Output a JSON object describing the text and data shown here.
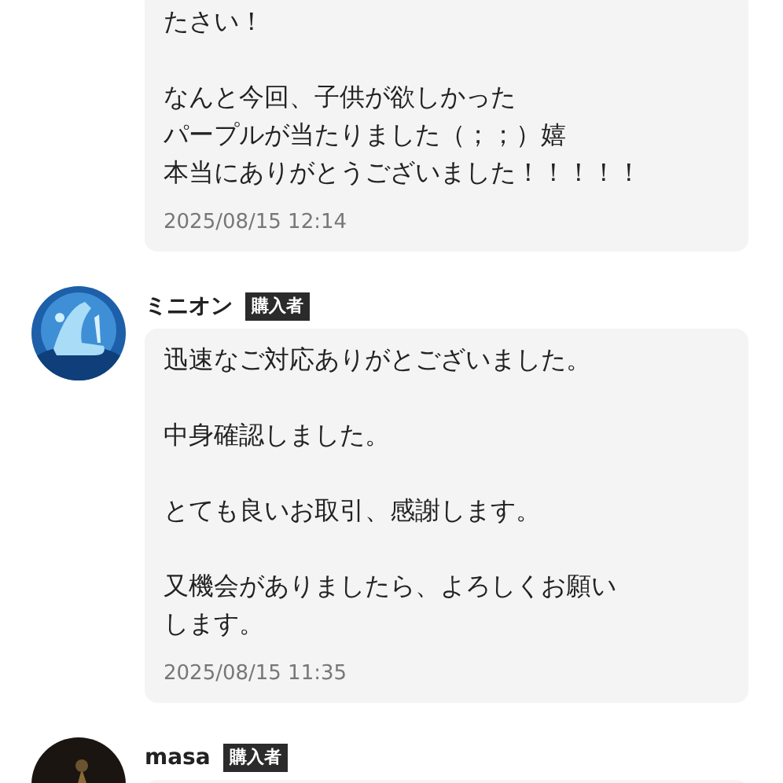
{
  "comments": [
    {
      "paragraphs": [
        [
          "たさい！"
        ],
        [
          "なんと今回、子供が欲しかった",
          "パープルが当たりました（；；）嬉",
          "本当にありがとうございました！！！！！"
        ]
      ],
      "timestamp": "2025/08/15 12:14"
    },
    {
      "avatar": {
        "kind": "picture"
      },
      "name": "ミニオン",
      "badge": "購入者",
      "paragraphs": [
        [
          "迅速なご対応ありがとございました。"
        ],
        [
          "中身確認しました。"
        ],
        [
          "とても良いお取引、感謝します。"
        ],
        [
          "又機会がありましたら、よろしくお願い",
          "します。"
        ]
      ],
      "timestamp": "2025/08/15 11:35"
    },
    {
      "avatar": {
        "kind": "picture"
      },
      "name": "masa",
      "badge": "購入者"
    }
  ]
}
